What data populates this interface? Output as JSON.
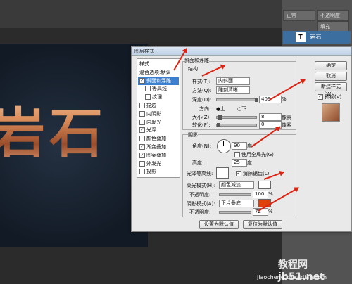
{
  "ps": {
    "layer_name": "岩石",
    "blend": "正常",
    "opacity_label": "不透明度",
    "fill_label": "填充"
  },
  "canvas": {
    "text": "岩石"
  },
  "dialog": {
    "title": "图层样式",
    "styles": [
      {
        "label": "样式",
        "checked": null
      },
      {
        "label": "混合选项:默认",
        "checked": null
      },
      {
        "label": "斜面和浮雕",
        "checked": true
      },
      {
        "label": "等高线",
        "checked": false
      },
      {
        "label": "纹理",
        "checked": false
      },
      {
        "label": "描边",
        "checked": false
      },
      {
        "label": "内阴影",
        "checked": false
      },
      {
        "label": "内发光",
        "checked": false
      },
      {
        "label": "光泽",
        "checked": true
      },
      {
        "label": "颜色叠加",
        "checked": false
      },
      {
        "label": "渐变叠加",
        "checked": true
      },
      {
        "label": "图案叠加",
        "checked": true
      },
      {
        "label": "外发光",
        "checked": false
      },
      {
        "label": "投影",
        "checked": false
      }
    ],
    "bevel": {
      "section": "斜面和浮雕",
      "structure": "结构",
      "style_label": "样式(T):",
      "style_value": "内斜面",
      "method_label": "方法(Q):",
      "method_value": "雕刻清晰",
      "depth_label": "深度(D):",
      "depth_value": "409",
      "pct": "%",
      "direction_label": "方向:",
      "dir_up": "上",
      "dir_down": "下",
      "size_label": "大小(Z):",
      "size_value": "8",
      "px": "像素",
      "soften_label": "软化(F):",
      "soften_value": "0"
    },
    "shading": {
      "section": "阴影",
      "angle_label": "角度(N):",
      "angle_value": "90",
      "deg": "度",
      "global": "使用全局光(G)",
      "altitude_label": "高度:",
      "altitude_value": "25",
      "gloss_label": "光泽等高线:",
      "anti": "消除锯齿(L)",
      "highlight_label": "高光模式(H):",
      "highlight_value": "颜色减淡",
      "opacity_label": "不透明度:",
      "hl_opacity": "100",
      "shadow_label": "阴影模式(A):",
      "shadow_value": "正片叠底",
      "sh_opacity": "72",
      "highlight_color": "#ffffff",
      "shadow_color": "#e0400a"
    },
    "buttons": {
      "ok": "确定",
      "cancel": "取消",
      "new_style": "新建样式(W)...",
      "preview": "预视(V)",
      "default_set": "设置为默认值",
      "default_reset": "复位为默认值"
    }
  },
  "watermark": {
    "site": "教程网",
    "domain": "jb51.net",
    "url": "jiaocheng.chazidian.com"
  }
}
